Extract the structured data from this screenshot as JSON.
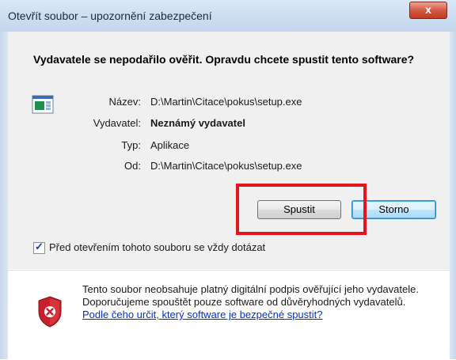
{
  "window": {
    "title": "Otevřít soubor – upozornění zabezpečení",
    "close_glyph": "x"
  },
  "question": "Vydavatele se nepodařilo ověřit. Opravdu chcete spustit tento software?",
  "file_icon": "application-file-icon",
  "details": {
    "name_label": "Název:",
    "name_value": "D:\\Martin\\Citace\\pokus\\setup.exe",
    "publisher_label": "Vydavatel:",
    "publisher_value": "Neznámý vydavatel",
    "type_label": "Typ:",
    "type_value": "Aplikace",
    "from_label": "Od:",
    "from_value": "D:\\Martin\\Citace\\pokus\\setup.exe"
  },
  "buttons": {
    "run": "Spustit",
    "cancel": "Storno"
  },
  "checkbox": {
    "label": "Před otevřením tohoto souboru se vždy dotázat",
    "checked": true
  },
  "warning": {
    "icon": "shield-error-icon",
    "text": "Tento soubor neobsahuje platný digitální podpis ověřující jeho vydavatele. Doporučujeme spouštět pouze software od důvěryhodných vydavatelů.",
    "link": "Podle čeho určit, který software je bezpečné spustit?"
  },
  "colors": {
    "highlight": "#e8131b",
    "link": "#0033cc"
  }
}
